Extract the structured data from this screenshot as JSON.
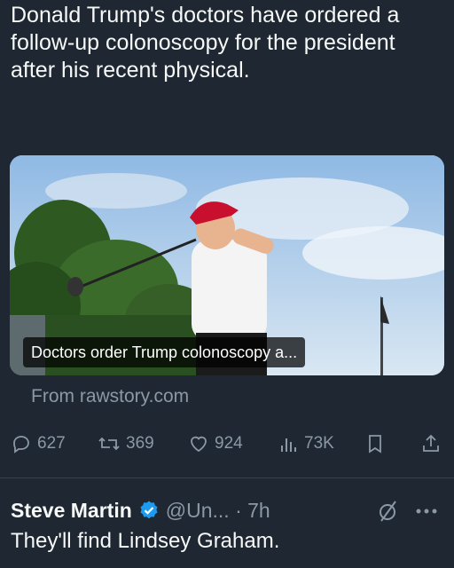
{
  "tweet": {
    "text": "Donald Trump's doctors have ordered a follow-up colonoscopy for the president after his recent physical."
  },
  "card": {
    "caption": "Doctors order Trump colonoscopy a...",
    "source": "From rawstory.com"
  },
  "actions": {
    "replies": "627",
    "reposts": "369",
    "likes": "924",
    "views": "73K"
  },
  "reply": {
    "name": "Steve Martin",
    "meta": "@Un... · 7h",
    "text": "They'll find Lindsey Graham."
  },
  "colors": {
    "background": "#1e2732",
    "text": "#f7f9f9",
    "muted": "#8b98a5",
    "verified": "#1d9bf0"
  },
  "icons": [
    "reply-icon",
    "repost-icon",
    "like-icon",
    "views-icon",
    "bookmark-icon",
    "share-icon",
    "verified-badge-icon",
    "grok-icon",
    "more-icon"
  ]
}
